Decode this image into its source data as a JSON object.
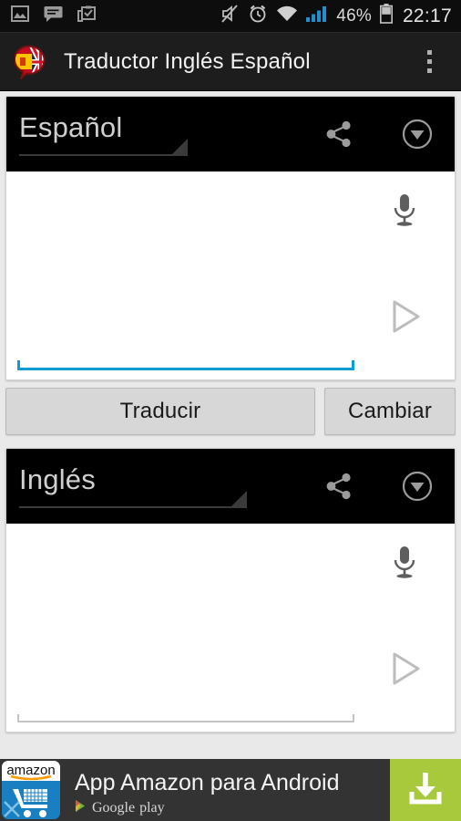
{
  "statusbar": {
    "left_icons": [
      "image-icon",
      "message-icon",
      "clipboard-check-icon"
    ],
    "mute_icon": "speaker-muted-icon",
    "alarm_icon": "alarm-clock-icon",
    "wifi_icon": "wifi-icon",
    "signal_icon": "cellular-signal-icon",
    "battery_percent": "46%",
    "battery_icon": "battery-icon",
    "clock": "22:17"
  },
  "actionbar": {
    "app_icon": "flags-speech-bubble-icon",
    "title": "Traductor Inglés Español",
    "overflow_icon": "overflow-menu-icon"
  },
  "source_panel": {
    "language": "Español",
    "share_icon": "share-icon",
    "collapse_icon": "circled-down-arrow-icon",
    "mic_icon": "microphone-icon",
    "play_icon": "play-icon",
    "input_value": "",
    "input_placeholder": "",
    "focused": true
  },
  "actions": {
    "translate_label": "Traducir",
    "swap_label": "Cambiar"
  },
  "target_panel": {
    "language": "Inglés",
    "share_icon": "share-icon",
    "collapse_icon": "circled-down-arrow-icon",
    "mic_icon": "microphone-icon",
    "play_icon": "play-icon",
    "input_value": "",
    "input_placeholder": "",
    "focused": false
  },
  "ad": {
    "icon": "amazon-app-icon",
    "brand_text": "amazon",
    "title": "App Amazon para Android",
    "store": "Google",
    "store_suffix": "play",
    "cta_icon": "download-icon",
    "close_icon": "close-icon"
  },
  "colors": {
    "accent_blue": "#0f9bd7",
    "ad_green": "#a9c93c",
    "statusbar_bg": "#0d0d0d",
    "actionbar_bg": "#1d1d1d",
    "panel_header_bg": "#000000",
    "page_bg": "#e9e9e9"
  }
}
